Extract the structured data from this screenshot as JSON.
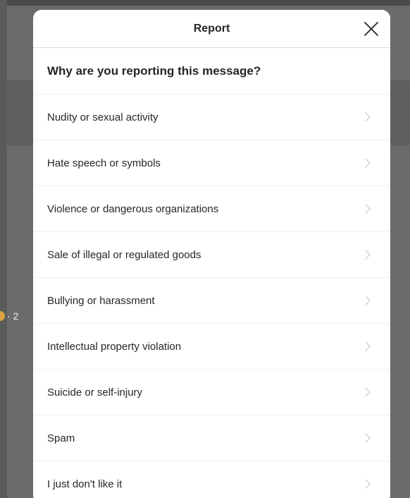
{
  "background": {
    "snippet_text": "· 2",
    "colors": {
      "overlay": "#6b6b6b"
    }
  },
  "modal": {
    "title": "Report",
    "close_icon": "close-icon",
    "question": "Why are you reporting this message?",
    "options": [
      {
        "label": "Nudity or sexual activity"
      },
      {
        "label": "Hate speech or symbols"
      },
      {
        "label": "Violence or dangerous organizations"
      },
      {
        "label": "Sale of illegal or regulated goods"
      },
      {
        "label": "Bullying or harassment"
      },
      {
        "label": "Intellectual property violation"
      },
      {
        "label": "Suicide or self-injury"
      },
      {
        "label": "Spam"
      },
      {
        "label": "I just don't like it"
      }
    ],
    "option_icon": "chevron-right-icon",
    "colors": {
      "text": "#262626",
      "divider": "#efefef",
      "chevron": "#c7c7c7"
    }
  }
}
